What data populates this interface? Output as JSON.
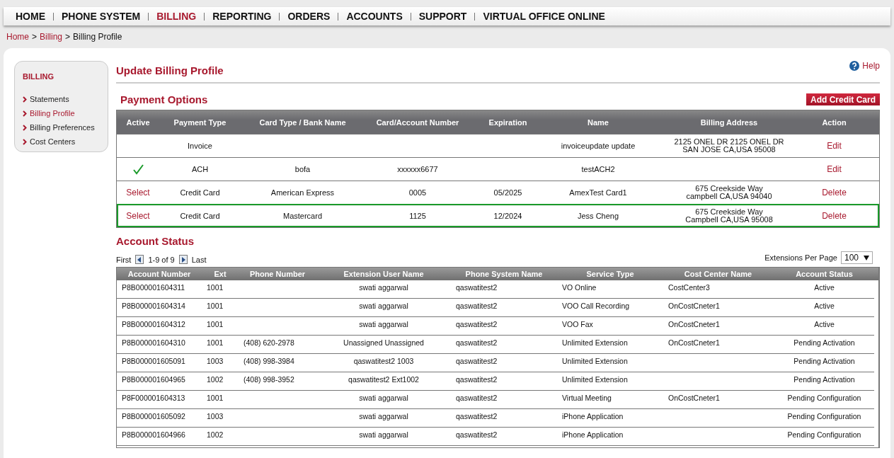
{
  "nav": [
    {
      "label": "HOME",
      "selected": false
    },
    {
      "label": "PHONE SYSTEM",
      "selected": false
    },
    {
      "label": "BILLING",
      "selected": true
    },
    {
      "label": "REPORTING",
      "selected": false
    },
    {
      "label": "ORDERS",
      "selected": false
    },
    {
      "label": "ACCOUNTS",
      "selected": false
    },
    {
      "label": "SUPPORT",
      "selected": false
    },
    {
      "label": "VIRTUAL OFFICE ONLINE",
      "selected": false
    }
  ],
  "breadcrumb": {
    "links": [
      "Home",
      "Billing"
    ],
    "current": "Billing Profile",
    "separator": ">"
  },
  "sidebar": {
    "title": "BILLING",
    "items": [
      {
        "label": "Statements",
        "selected": false
      },
      {
        "label": "Billing Profile",
        "selected": true
      },
      {
        "label": "Billing Preferences",
        "selected": false
      },
      {
        "label": "Cost Centers",
        "selected": false
      }
    ]
  },
  "page_title": "Update Billing Profile",
  "help": "Help",
  "payment_options": {
    "title": "Payment Options",
    "add_button": "Add Credit Card",
    "columns": [
      "Active",
      "Payment Type",
      "Card Type / Bank Name",
      "Card/Account Number",
      "Expiration",
      "Name",
      "Billing Address",
      "Action"
    ],
    "rows": [
      {
        "active": false,
        "select": "",
        "payment_type": "Invoice",
        "card_type": "",
        "number": "",
        "expiration": "",
        "name": "invoiceupdate update",
        "address": [
          "2125 ONEL DR 2125 ONEL DR",
          "SAN JOSE CA,USA 95008"
        ],
        "action": "Edit",
        "selected": false
      },
      {
        "active": true,
        "select": "",
        "payment_type": "ACH",
        "card_type": "bofa",
        "number": "xxxxxx6677",
        "expiration": "",
        "name": "testACH2",
        "address": [],
        "action": "Edit",
        "selected": false
      },
      {
        "active": false,
        "select": "Select",
        "payment_type": "Credit Card",
        "card_type": "American Express",
        "number": "0005",
        "expiration": "05/2025",
        "name": "AmexTest Card1",
        "address": [
          "675 Creekside Way",
          "campbell CA,USA 94040"
        ],
        "action": "Delete",
        "selected": false
      },
      {
        "active": false,
        "select": "Select",
        "payment_type": "Credit Card",
        "card_type": "Mastercard",
        "number": "1125",
        "expiration": "12/2024",
        "name": "Jess Cheng",
        "address": [
          "675 Creekside Way",
          "Campbell CA,USA 95008"
        ],
        "action": "Delete",
        "selected": true
      }
    ]
  },
  "account_status": {
    "title": "Account Status",
    "pager": {
      "first": "First",
      "range": "1-9 of 9",
      "last": "Last"
    },
    "per_page_label": "Extensions Per Page",
    "per_page": "100",
    "columns": [
      "Account Number",
      "Ext",
      "Phone Number",
      "Extension User Name",
      "Phone System Name",
      "Service Type",
      "Cost Center Name",
      "Account Status"
    ],
    "rows": [
      [
        "P8B000001604311",
        "1001",
        "",
        "swati aggarwal",
        "qaswatitest2",
        "VO Online",
        "CostCenter3",
        "Active"
      ],
      [
        "P8B000001604314",
        "1001",
        "",
        "swati aggarwal",
        "qaswatitest2",
        "VOO Call Recording",
        "OnCostCneter1",
        "Active"
      ],
      [
        "P8B000001604312",
        "1001",
        "",
        "swati aggarwal",
        "qaswatitest2",
        "VOO Fax",
        "OnCostCneter1",
        "Active"
      ],
      [
        "P8B000001604310",
        "1001",
        "(408) 620-2978",
        "Unassigned Unassigned",
        "qaswatitest2",
        "Unlimited Extension",
        "OnCostCneter1",
        "Pending Activation"
      ],
      [
        "P8B000001605091",
        "1003",
        "(408) 998-3984",
        "qaswatitest2 1003",
        "qaswatitest2",
        "Unlimited Extension",
        "",
        "Pending Activation"
      ],
      [
        "P8B000001604965",
        "1002",
        "(408) 998-3952",
        "qaswatitest2 Ext1002",
        "qaswatitest2",
        "Unlimited Extension",
        "",
        "Pending Activation"
      ],
      [
        "P8F000001604313",
        "1001",
        "",
        "swati aggarwal",
        "qaswatitest2",
        "Virtual Meeting",
        "OnCostCneter1",
        "Pending Configuration"
      ],
      [
        "P8B000001605092",
        "1003",
        "",
        "swati aggarwal",
        "qaswatitest2",
        "iPhone Application",
        "",
        "Pending Configuration"
      ],
      [
        "P8B000001604966",
        "1002",
        "",
        "swati aggarwal",
        "qaswatitest2",
        "iPhone Application",
        "",
        "Pending Configuration"
      ]
    ]
  }
}
